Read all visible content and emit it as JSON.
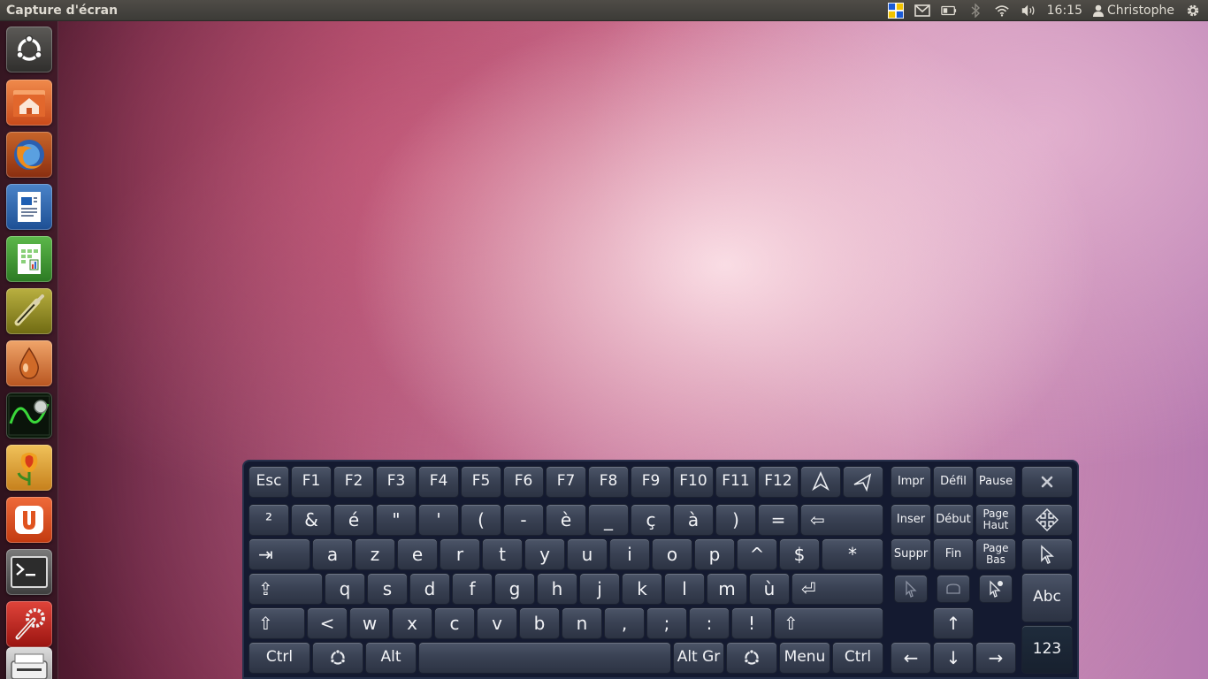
{
  "top_panel": {
    "app_title": "Capture d'écran",
    "clock": "16:15",
    "username": "Christophe",
    "tray_icons": [
      "keyboard-layout-icon",
      "mail-icon",
      "battery-icon",
      "bluetooth-icon",
      "wifi-icon",
      "volume-icon",
      "user-icon",
      "gear-icon"
    ]
  },
  "launcher": {
    "items": [
      "dash-home",
      "home-folder",
      "firefox",
      "libreoffice-writer",
      "libreoffice-calc",
      "audio-jack",
      "drop-app",
      "oscilloscope",
      "flower-app",
      "ubuntu-one",
      "terminal",
      "system-settings",
      "scanner"
    ]
  },
  "keyboard": {
    "row1": [
      "Esc",
      "F1",
      "F2",
      "F3",
      "F4",
      "F5",
      "F6",
      "F7",
      "F8",
      "F9",
      "F10",
      "F11",
      "F12"
    ],
    "row2": [
      "²",
      "&",
      "é",
      "\"",
      "'",
      "(",
      "-",
      "è",
      "_",
      "ç",
      "à",
      ")",
      "="
    ],
    "row3": [
      "a",
      "z",
      "e",
      "r",
      "t",
      "y",
      "u",
      "i",
      "o",
      "p",
      "^",
      "$",
      "*"
    ],
    "row4": [
      "q",
      "s",
      "d",
      "f",
      "g",
      "h",
      "j",
      "k",
      "l",
      "m",
      "ù"
    ],
    "row5": [
      "<",
      "w",
      "x",
      "c",
      "v",
      "b",
      "n",
      ",",
      ";",
      ":",
      "!"
    ],
    "bottom": {
      "ctrl_left": "Ctrl",
      "alt": "Alt",
      "altgr": "Alt Gr",
      "menu": "Menu",
      "ctrl_right": "Ctrl"
    },
    "nav": {
      "impr": "Impr",
      "defil": "Défil",
      "pause": "Pause",
      "inser": "Inser",
      "debut": "Début",
      "page_haut": "Page\nHaut",
      "suppr": "Suppr",
      "fin": "Fin",
      "page_bas": "Page\nBas"
    },
    "arrows": {
      "up": "↑",
      "left": "←",
      "down": "↓",
      "right": "→"
    },
    "symbols": {
      "backspace": "⇦",
      "tab": "⇥",
      "capslock": "⇪",
      "enter": "⏎",
      "shift": "⇧"
    },
    "side": {
      "abc": "Abc",
      "num": "123"
    }
  }
}
